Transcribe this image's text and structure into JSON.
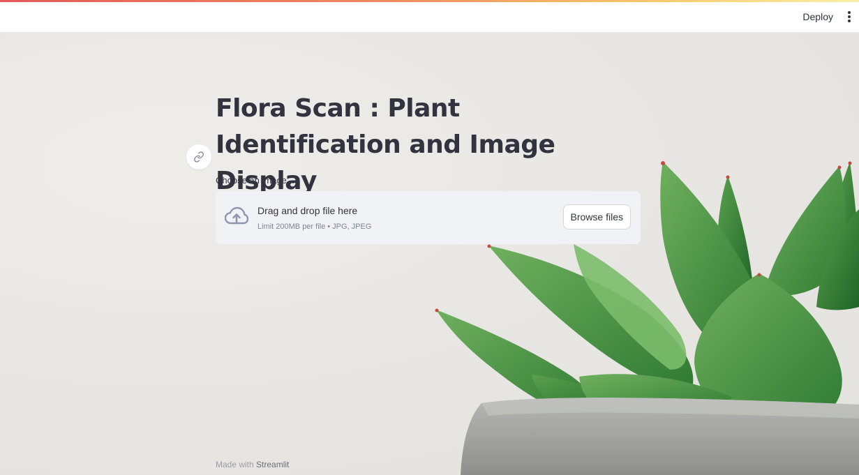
{
  "header": {
    "deploy_label": "Deploy",
    "menu_icon": "vertical-ellipsis-icon"
  },
  "main": {
    "anchor_icon": "link-icon",
    "title": "Flora Scan : Plant Identification and Image Display"
  },
  "uploader": {
    "label": "Choose an image...",
    "drop_title": "Drag and drop file here",
    "limit_text": "Limit 200MB per file • JPG, JPEG",
    "browse_label": "Browse files",
    "icon": "cloud-upload-icon"
  },
  "footer": {
    "prefix": "Made with ",
    "brand": "Streamlit"
  },
  "colors": {
    "accent_gradient_start": "#e35a5a",
    "accent_gradient_end": "#fbf0a6",
    "text": "#31333f",
    "dropzone_bg": "#f0f2f6",
    "plant_green": "#3f8c3f",
    "pot_gray": "#a9aaa8"
  }
}
